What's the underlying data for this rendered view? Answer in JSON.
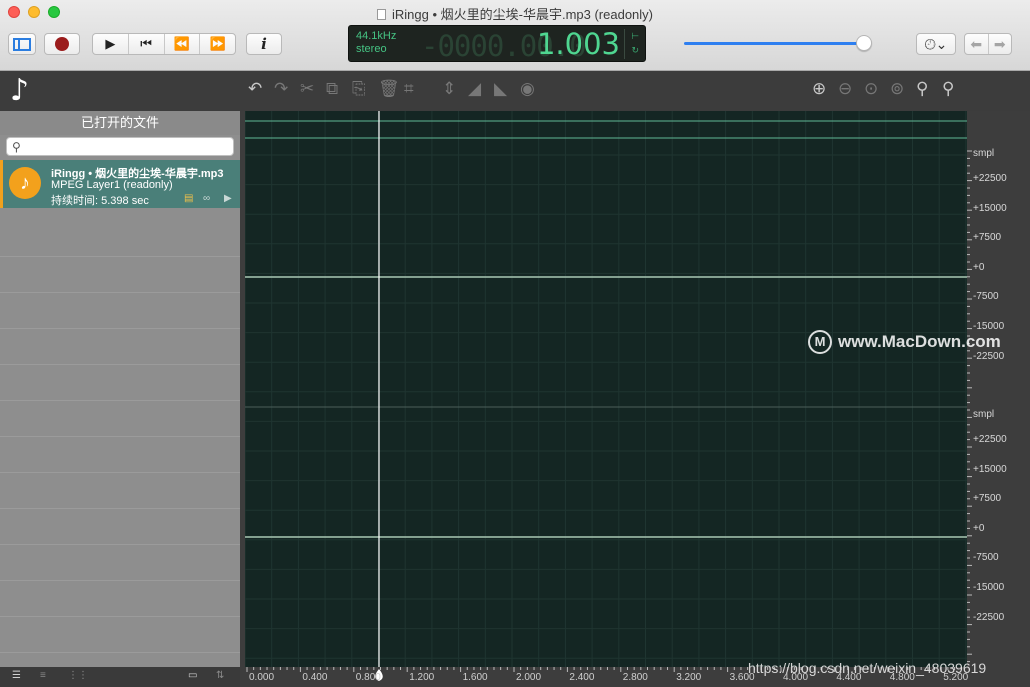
{
  "window": {
    "title": "iRingg • 烟火里的尘埃-华晨宇.mp3 (readonly)"
  },
  "toolbar": {
    "sidebar_icon": "sidebar-icon",
    "record_icon": "record-icon",
    "play_icon": "play-icon",
    "skip_start_icon": "skip-start-icon",
    "rewind_icon": "rewind-icon",
    "fast_forward_icon": "fast-forward-icon",
    "info_label": "i",
    "history_icon": "history-icon"
  },
  "lcd": {
    "sample_rate": "44.1kHz",
    "channels": "stereo",
    "time_ghost": "-0000.00.0",
    "time": "1.003",
    "accent_color": "#4fd691"
  },
  "volume": {
    "level": 0.97
  },
  "sidebar": {
    "header": "已打开的文件",
    "search_placeholder": "",
    "file": {
      "name": "iRingg • 烟火里的尘埃-华晨宇.mp3",
      "format": "MPEG Layer1 (readonly)",
      "duration": "持续时间: 5.398 sec"
    }
  },
  "scale": {
    "unit": "smpl",
    "upper": [
      "+22500",
      "+15000",
      "+7500",
      "+0",
      "-7500",
      "-15000",
      "-22500"
    ],
    "lower": [
      "+22500",
      "+15000",
      "+7500",
      "+0",
      "-7500",
      "-15000",
      "-22500"
    ]
  },
  "ruler": {
    "ticks": [
      "0.000",
      "0.400",
      "0.800",
      "1.200",
      "1.600",
      "2.000",
      "2.400",
      "2.800",
      "3.200",
      "3.600",
      "4.000",
      "4.400",
      "4.800",
      "5.200"
    ]
  },
  "watermarks": {
    "macdown": "www.MacDown.com",
    "csdn": "https://blog.csdn.net/weixin_48039619"
  },
  "colors": {
    "waveform_bg": "#142623",
    "waveform_line": "#8fd0b0",
    "playhead": "#ffffff",
    "file_highlight": "#4a7f79",
    "file_accent": "#f0a11e"
  }
}
